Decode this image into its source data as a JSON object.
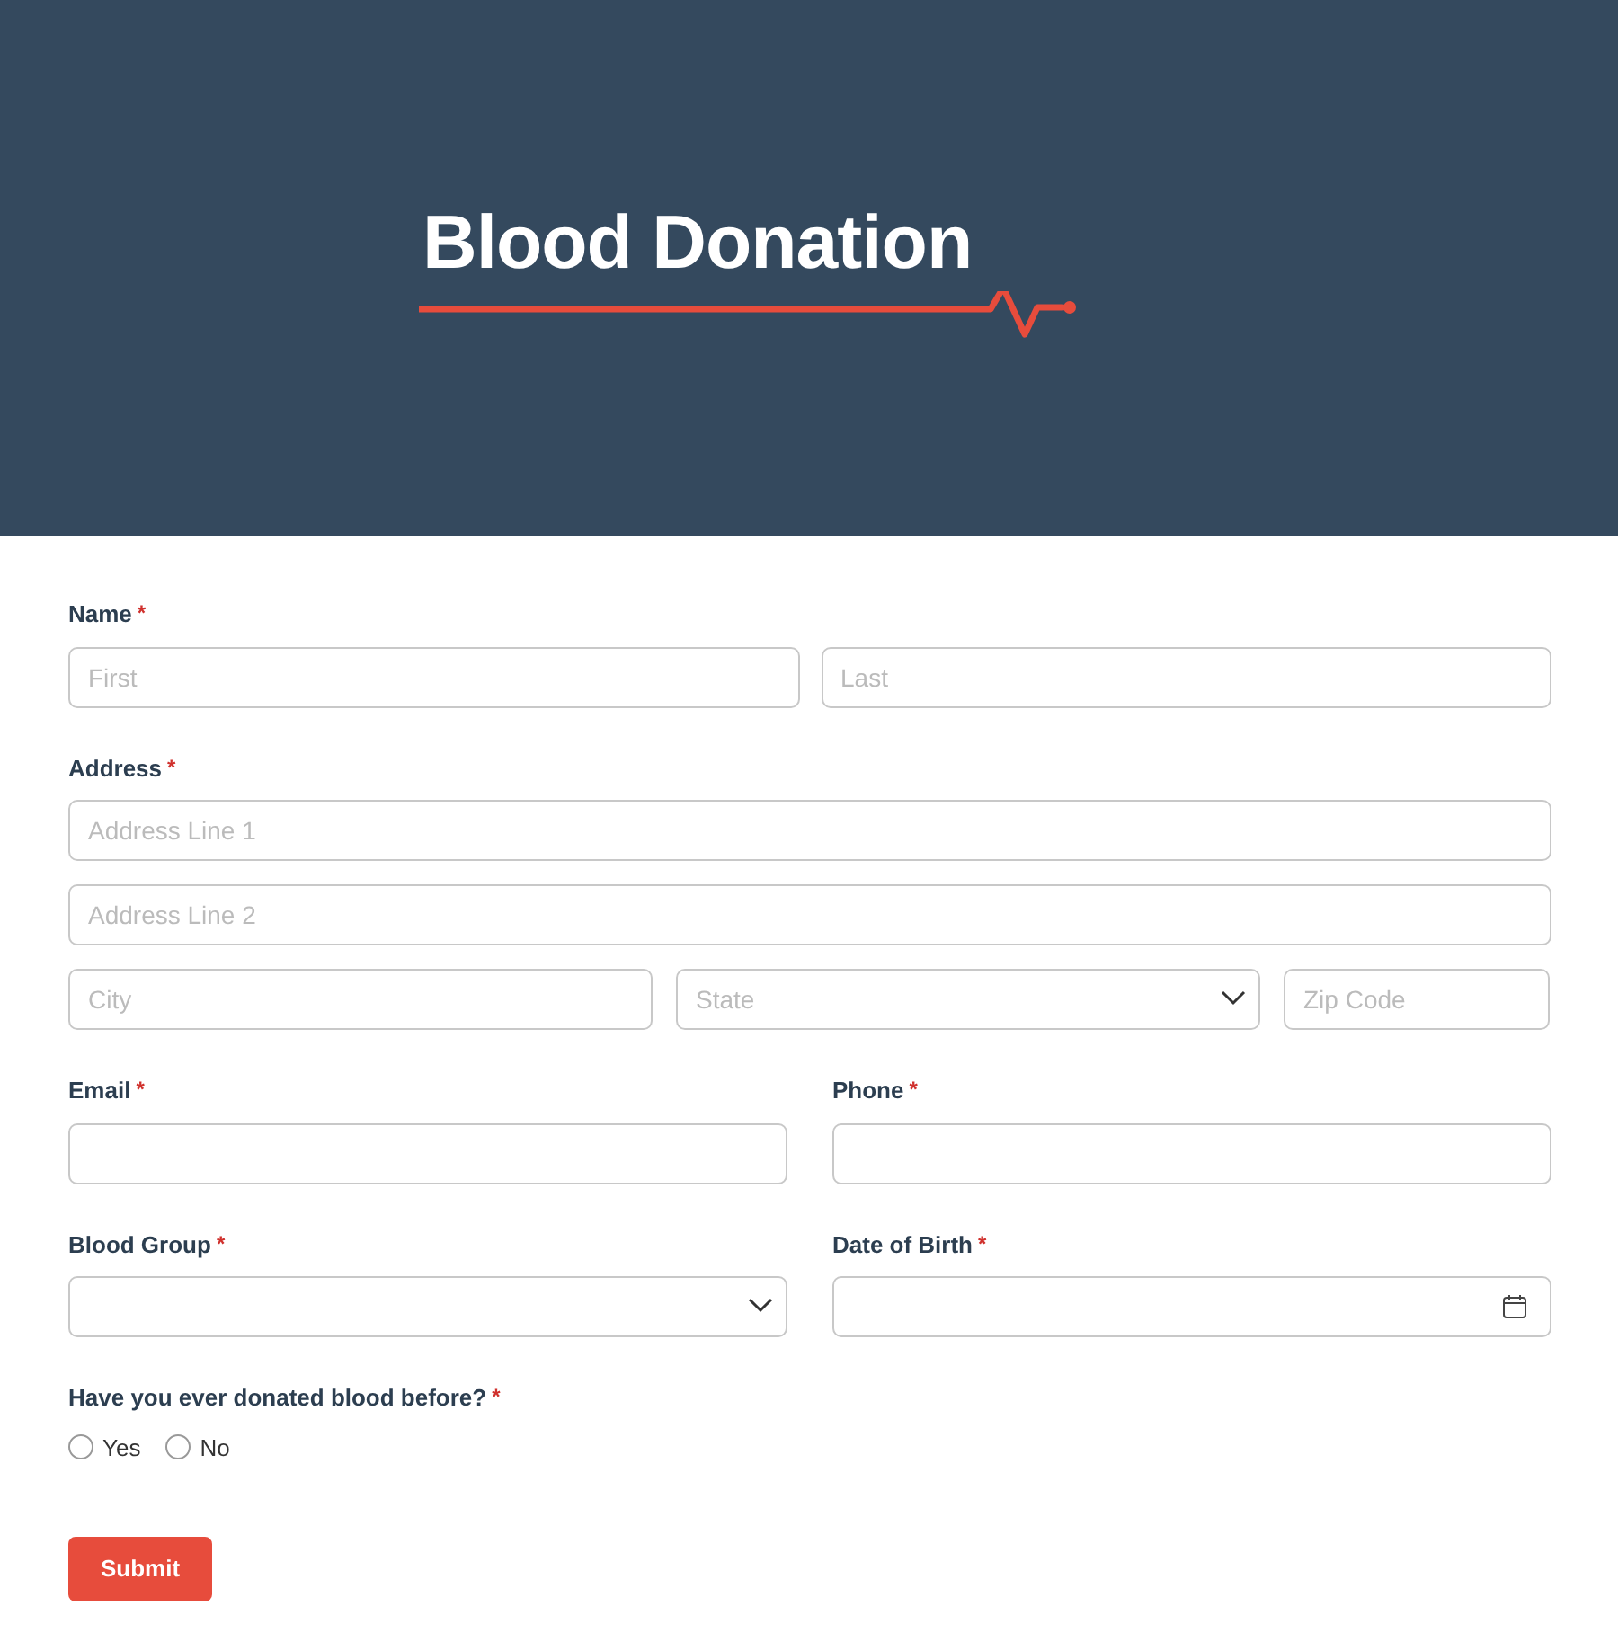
{
  "header": {
    "logo_text": "Blood Donation"
  },
  "form": {
    "rows": [
      [
        {
          "label": "Name",
          "required_mark": "*",
          "kind": "inputs",
          "lines": [
            [
              {
                "kind": "text",
                "placeholder": "First"
              },
              {
                "kind": "text",
                "placeholder": "Last"
              }
            ]
          ]
        }
      ],
      [
        {
          "label": "Address",
          "required_mark": "*",
          "kind": "inputs",
          "lines": [
            [
              {
                "kind": "text",
                "placeholder": "Address Line 1"
              }
            ],
            [
              {
                "kind": "text",
                "placeholder": "Address Line 2"
              }
            ],
            [
              {
                "kind": "text",
                "placeholder": "City"
              },
              {
                "kind": "select",
                "placeholder": "State"
              },
              {
                "kind": "text",
                "placeholder": "Zip Code"
              }
            ]
          ]
        }
      ],
      [
        {
          "label": "Email",
          "required_mark": "*",
          "kind": "inputs",
          "lines": [
            [
              {
                "kind": "text"
              }
            ]
          ]
        },
        {
          "label": "Phone",
          "required_mark": "*",
          "kind": "inputs",
          "lines": [
            [
              {
                "kind": "text"
              }
            ]
          ]
        }
      ],
      [
        {
          "label": "Blood Group",
          "required_mark": "*",
          "kind": "inputs",
          "lines": [
            [
              {
                "kind": "select"
              }
            ]
          ]
        },
        {
          "label": "Date of Birth",
          "required_mark": "*",
          "kind": "inputs",
          "lines": [
            [
              {
                "kind": "date"
              }
            ]
          ]
        }
      ],
      [
        {
          "label": "Have you ever donated blood before?",
          "required_mark": "*",
          "kind": "radio",
          "options": [
            {
              "label": "Yes",
              "selected": false
            },
            {
              "label": "No",
              "selected": false
            }
          ]
        }
      ]
    ],
    "submit": "Submit"
  }
}
